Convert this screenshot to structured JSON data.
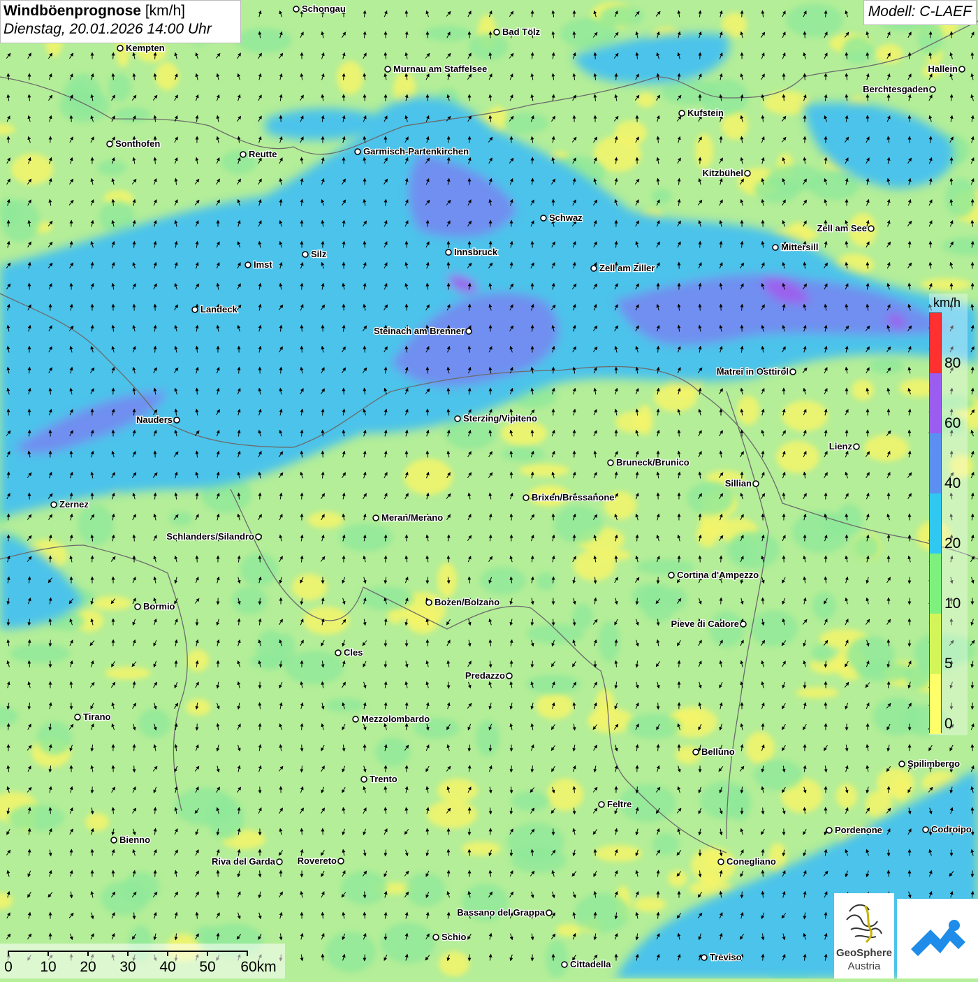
{
  "title": {
    "main": "Windböenprognose",
    "unit": "[km/h]",
    "date": "Dienstag, 20.01.2026 14:00 Uhr"
  },
  "model": "Modell: C-LAEF",
  "legend": {
    "unit": "km/h",
    "labels": [
      "80",
      "60",
      "40",
      "20",
      "10",
      "5",
      "0"
    ],
    "colors": [
      "#ff3030",
      "#9b5cf0",
      "#5b8ff0",
      "#30c8f0",
      "#7ef07e",
      "#d4f55a",
      "#ffff6a"
    ]
  },
  "scale": {
    "labels": [
      "0",
      "10",
      "20",
      "30",
      "40",
      "50",
      "60km"
    ]
  },
  "logo": {
    "name_line1": "GeoSphere",
    "name_line2": "Austria"
  },
  "cities": [
    {
      "name": "Schongau",
      "label_side": "right"
    },
    {
      "name": "Bad Tölz",
      "label_side": "right"
    },
    {
      "name": "Kempten",
      "label_side": "right"
    },
    {
      "name": "Murnau am Staffelsee",
      "label_side": "right"
    },
    {
      "name": "Hallein",
      "label_side": "left"
    },
    {
      "name": "Berchtesgaden",
      "label_side": "left"
    },
    {
      "name": "Kufstein",
      "label_side": "right"
    },
    {
      "name": "Sonthofen",
      "label_side": "right"
    },
    {
      "name": "Reutte",
      "label_side": "right"
    },
    {
      "name": "Garmisch-Partenkirchen",
      "label_side": "right"
    },
    {
      "name": "Kitzbühel",
      "label_side": "left"
    },
    {
      "name": "Schwaz",
      "label_side": "right"
    },
    {
      "name": "Zell am See",
      "label_side": "left"
    },
    {
      "name": "Innsbruck",
      "label_side": "right"
    },
    {
      "name": "Mittersill",
      "label_side": "right"
    },
    {
      "name": "Imst",
      "label_side": "right"
    },
    {
      "name": "Silz",
      "label_side": "right"
    },
    {
      "name": "Zell am Ziller",
      "label_side": "right"
    },
    {
      "name": "Landeck",
      "label_side": "right"
    },
    {
      "name": "Steinach am Brenner",
      "label_side": "left"
    },
    {
      "name": "Matrei in Osttirol",
      "label_side": "left"
    },
    {
      "name": "Nauders",
      "label_side": "left"
    },
    {
      "name": "Sterzing/Vipiteno",
      "label_side": "right"
    },
    {
      "name": "Lienz",
      "label_side": "left"
    },
    {
      "name": "Bruneck/Brunico",
      "label_side": "right"
    },
    {
      "name": "Sillian",
      "label_side": "left"
    },
    {
      "name": "Zernez",
      "label_side": "right"
    },
    {
      "name": "Brixen/Bressanone",
      "label_side": "right"
    },
    {
      "name": "Meran/Merano",
      "label_side": "right"
    },
    {
      "name": "Schlanders/Silandro",
      "label_side": "left"
    },
    {
      "name": "Cortina d'Ampezzo",
      "label_side": "right"
    },
    {
      "name": "Bozen/Bolzano",
      "label_side": "right"
    },
    {
      "name": "Bormio",
      "label_side": "right"
    },
    {
      "name": "Pieve di Cadore",
      "label_side": "left"
    },
    {
      "name": "Cles",
      "label_side": "right"
    },
    {
      "name": "Predazzo",
      "label_side": "left"
    },
    {
      "name": "Tirano",
      "label_side": "right"
    },
    {
      "name": "Mezzolombardo",
      "label_side": "right"
    },
    {
      "name": "Belluno",
      "label_side": "right"
    },
    {
      "name": "Spilimbergo",
      "label_side": "right"
    },
    {
      "name": "Trento",
      "label_side": "right"
    },
    {
      "name": "Feltre",
      "label_side": "right"
    },
    {
      "name": "Pordenone",
      "label_side": "right"
    },
    {
      "name": "Codroipo",
      "label_side": "right"
    },
    {
      "name": "Bienno",
      "label_side": "right"
    },
    {
      "name": "Riva del Garda",
      "label_side": "left"
    },
    {
      "name": "Rovereto",
      "label_side": "left"
    },
    {
      "name": "Conegliano",
      "label_side": "right"
    },
    {
      "name": "Bassano del Grappa",
      "label_side": "left"
    },
    {
      "name": "Schio",
      "label_side": "right"
    },
    {
      "name": "Treviso",
      "label_side": "right"
    },
    {
      "name": "Cittadella",
      "label_side": "right"
    }
  ]
}
